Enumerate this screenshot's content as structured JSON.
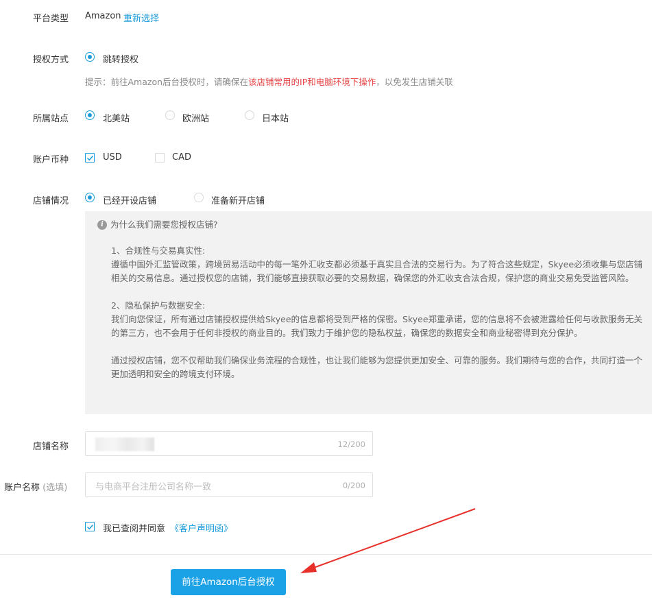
{
  "platform": {
    "label": "平台类型",
    "value": "Amazon",
    "reselect": "重新选择"
  },
  "auth": {
    "label": "授权方式",
    "option": "跳转授权",
    "hint_prefix": "提示：前往Amazon后台授权时，请确保在",
    "hint_warn": "该店铺常用的IP和电脑环境下操作",
    "hint_suffix": "，以免发生店铺关联"
  },
  "site": {
    "label": "所属站点",
    "options": [
      "北美站",
      "欧洲站",
      "日本站"
    ],
    "selected": "北美站"
  },
  "currency": {
    "label": "账户币种",
    "options": [
      {
        "name": "USD",
        "checked": true
      },
      {
        "name": "CAD",
        "checked": false
      }
    ]
  },
  "store_status": {
    "label": "店铺情况",
    "options": [
      "已经开设店铺",
      "准备新开店铺"
    ],
    "selected": "已经开设店铺"
  },
  "info": {
    "title": "为什么我们需要您授权店铺?",
    "sec1_title": "1、合规性与交易真实性:",
    "sec1_body": "遵循中国外汇监管政策，跨境贸易活动中的每一笔外汇收支都必须基于真实且合法的交易行为。为了符合这些规定，Skyee必须收集与您店铺相关的交易信息。通过授权您的店铺，我们能够直接获取必要的交易数据，确保您的外汇收支合法合规，保护您的商业交易免受监管风险。",
    "sec2_title": "2、隐私保护与数据安全:",
    "sec2_body": "我们向您保证，所有通过店铺授权提供给Skyee的信息都将受到严格的保密。Skyee郑重承诺，您的信息将不会被泄露给任何与收款服务无关的第三方，也不会用于任何非授权的商业目的。我们致力于维护您的隐私权益，确保您的数据安全和商业秘密得到充分保护。",
    "closing": "通过授权店铺，您不仅帮助我们确保业务流程的合规性，也让我们能够为您提供更加安全、可靠的服务。我们期待与您的合作，共同打造一个更加透明和安全的跨境支付环境。"
  },
  "store_name": {
    "label": "店铺名称",
    "count": "12/200"
  },
  "account_name": {
    "label": "账户名称",
    "optional": "(选填)",
    "placeholder": "与电商平台注册公司名称一致",
    "count": "0/200"
  },
  "agreement": {
    "text": "我已查阅并同意",
    "link": "《客户声明函》",
    "checked": true
  },
  "submit": {
    "label": "前往Amazon后台授权"
  },
  "colors": {
    "accent": "#1b9bdb",
    "warn": "#e64545",
    "button": "#1ba1e6",
    "arrow": "#e8302a"
  }
}
